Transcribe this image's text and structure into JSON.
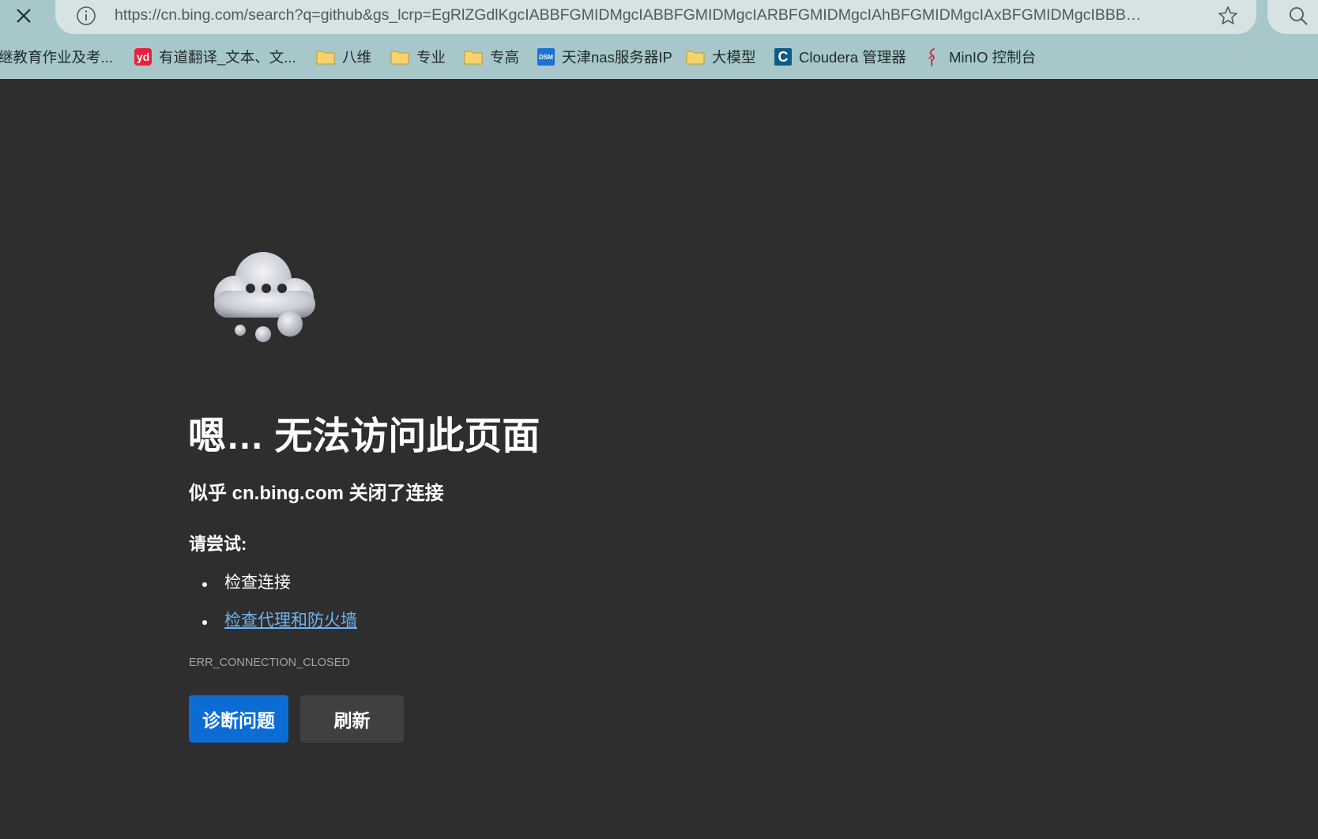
{
  "browser": {
    "url": "https://cn.bing.com/search?q=github&gs_lcrp=EgRlZGdlKgcIABBFGMIDMgcIABBFGMIDMgcIARBFGMIDMgcIAhBFGMIDMgcIAxBFGMIDMgcIBBBF...",
    "bookmarks": [
      {
        "label": "继教育作业及考...",
        "icon": "bookmark-icon"
      },
      {
        "label": "有道翻译_文本、文...",
        "icon": "youdao-icon"
      },
      {
        "label": "八维",
        "icon": "folder-icon"
      },
      {
        "label": "专业",
        "icon": "folder-icon"
      },
      {
        "label": "专高",
        "icon": "folder-icon"
      },
      {
        "label": "天津nas服务器IP",
        "icon": "synology-dsm-icon"
      },
      {
        "label": "大模型",
        "icon": "folder-icon"
      },
      {
        "label": "Cloudera 管理器",
        "icon": "cloudera-icon"
      },
      {
        "label": "MinIO 控制台",
        "icon": "minio-icon"
      }
    ],
    "icons": {
      "yd_text": "yd",
      "dsm_text": "DSM",
      "cloudera_text": "C"
    }
  },
  "error_page": {
    "title": "嗯… 无法访问此页面",
    "subtitle": "似乎 cn.bing.com 关闭了连接",
    "try_label": "请尝试:",
    "suggestions": [
      {
        "text": "检查连接",
        "link": false
      },
      {
        "text": "检查代理和防火墙",
        "link": true
      }
    ],
    "error_code": "ERR_CONNECTION_CLOSED",
    "diagnose_button": "诊断问题",
    "refresh_button": "刷新"
  },
  "colors": {
    "page_background": "#2e2e2e",
    "toolbar_background": "#a7c7ca",
    "primary_button": "#0b6cd4",
    "secondary_button": "#404040",
    "link": "#6cb4f2"
  }
}
